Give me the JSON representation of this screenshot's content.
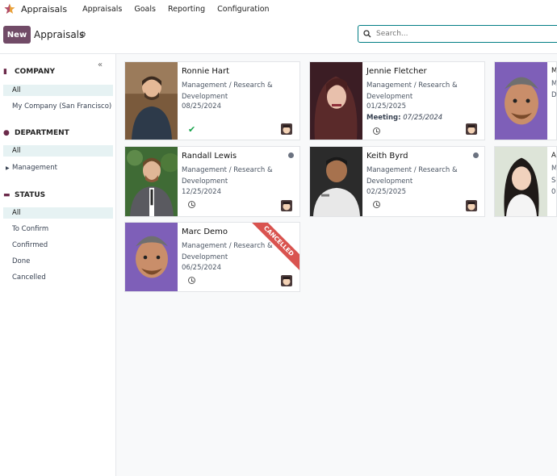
{
  "navbar": {
    "app_name": "Appraisals",
    "menu": [
      "Appraisals",
      "Goals",
      "Reporting",
      "Configuration"
    ]
  },
  "controlbar": {
    "new_label": "New",
    "title": "Appraisals",
    "search_placeholder": "Search..."
  },
  "sidebar": {
    "company": {
      "label": "COMPANY",
      "items": [
        "All",
        "My Company (San Francisco)"
      ]
    },
    "department": {
      "label": "DEPARTMENT",
      "items": [
        "All",
        "Management"
      ]
    },
    "status": {
      "label": "STATUS",
      "items": [
        "All",
        "To Confirm",
        "Confirmed",
        "Done",
        "Cancelled"
      ]
    }
  },
  "cards": [
    {
      "name": "Ronnie Hart",
      "dept1": "Management / Research &",
      "dept2": "Development",
      "date": "08/25/2024",
      "status": "done"
    },
    {
      "name": "Jennie Fletcher",
      "dept1": "Management / Research &",
      "dept2": "Development",
      "date": "01/25/2025",
      "meeting_label": "Meeting:",
      "meeting_date": "07/25/2024"
    },
    {
      "name": "Randall Lewis",
      "dept1": "Management / Research &",
      "dept2": "Development",
      "date": "12/25/2024"
    },
    {
      "name": "Keith Byrd",
      "dept1": "Management / Research &",
      "dept2": "Development",
      "date": "02/25/2025"
    },
    {
      "name": "Marc Demo",
      "dept1": "Management / Research &",
      "dept2": "Development",
      "date": "06/25/2024",
      "ribbon": "CANCELLED"
    }
  ],
  "partial_cards": [
    {
      "lines": [
        "M",
        "M",
        "D"
      ]
    },
    {
      "lines": [
        "A",
        "M",
        "Se",
        "0("
      ]
    }
  ],
  "colors": {
    "brand": "#714b67",
    "accent": "#017e84",
    "ribbon": "#d9534f",
    "done": "#16a34a"
  }
}
